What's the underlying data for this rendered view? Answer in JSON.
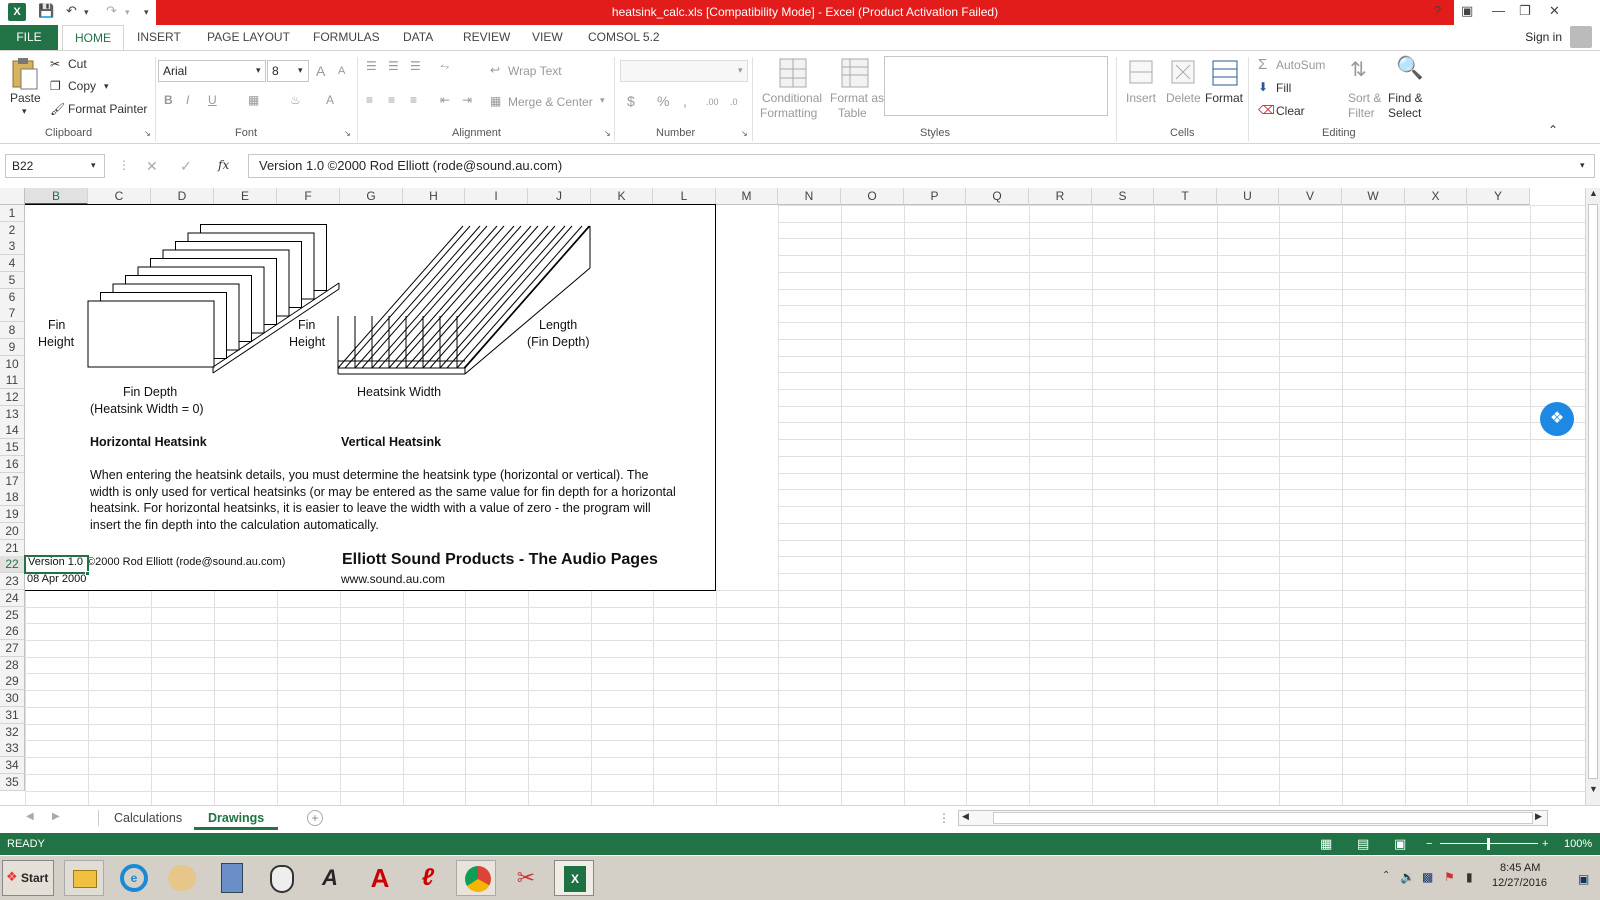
{
  "window": {
    "title": "heatsink_calc.xls  [Compatibility Mode] -  Excel (Product Activation Failed)",
    "help": "?",
    "min": "—",
    "max": "❐",
    "close": "✕"
  },
  "ribbon_tabs": [
    "FILE",
    "HOME",
    "INSERT",
    "PAGE LAYOUT",
    "FORMULAS",
    "DATA",
    "REVIEW",
    "VIEW",
    "COMSOL 5.2"
  ],
  "sign_in": "Sign in",
  "clipboard": {
    "paste": "Paste",
    "cut": "Cut",
    "copy": "Copy",
    "format_painter": "Format Painter",
    "label": "Clipboard"
  },
  "font": {
    "name": "Arial",
    "size": "8",
    "bold": "B",
    "italic": "I",
    "underline": "U",
    "label": "Font",
    "grow": "A",
    "shrink": "A",
    "color": "A"
  },
  "alignment": {
    "wrap_text": "Wrap Text",
    "merge_center": "Merge & Center",
    "label": "Alignment"
  },
  "number": {
    "format": "",
    "currency": "$",
    "percent": "%",
    "comma": ",",
    "inc_decimal": ".00",
    "dec_decimal": ".0",
    "label": "Number"
  },
  "styles": {
    "conditional": "Conditional",
    "conditional2": "Formatting",
    "format_as": "Format as",
    "format_as2": "Table",
    "label": "Styles"
  },
  "cells": {
    "insert": "Insert",
    "delete": "Delete",
    "format": "Format",
    "label": "Cells"
  },
  "editing": {
    "autosum": "AutoSum",
    "fill": "Fill",
    "clear": "Clear",
    "sort": "Sort &",
    "sort2": "Filter",
    "find": "Find &",
    "find2": "Select",
    "label": "Editing"
  },
  "formula_bar": {
    "name_box": "B22",
    "fx": "fx",
    "cancel": "✕",
    "enter": "✓",
    "content": "Version 1.0  ©2000 Rod Elliott (rode@sound.au.com)"
  },
  "columns": [
    "B",
    "C",
    "D",
    "E",
    "F",
    "G",
    "H",
    "I",
    "J",
    "K",
    "L",
    "M",
    "N",
    "O",
    "P",
    "Q",
    "R",
    "S",
    "T",
    "U",
    "V",
    "W",
    "X",
    "Y"
  ],
  "rows": [
    "1",
    "2",
    "3",
    "4",
    "5",
    "6",
    "7",
    "8",
    "9",
    "10",
    "11",
    "12",
    "13",
    "14",
    "15",
    "16",
    "17",
    "18",
    "19",
    "20",
    "21",
    "22",
    "23",
    "24",
    "25",
    "26",
    "27",
    "28",
    "29",
    "30",
    "31",
    "32",
    "33",
    "34",
    "35"
  ],
  "drawing": {
    "fin_height_left_1": "Fin",
    "fin_height_left_2": "Height",
    "fin_height_mid_1": "Fin",
    "fin_height_mid_2": "Height",
    "length_1": "Length",
    "length_2": "(Fin Depth)",
    "fin_depth_1": "Fin Depth",
    "fin_depth_2": "(Heatsink Width = 0)",
    "heatsink_width": "Heatsink Width",
    "horizontal": "Horizontal Heatsink",
    "vertical": "Vertical Heatsink",
    "para_1": "When entering the heatsink details, you must determine the heatsink type (horizontal or vertical).  The",
    "para_2": "width is only used for vertical heatsinks (or may be entered as the same value for fin depth for a horizontal",
    "para_3": "heatsink.  For horizontal heatsinks, it is easier to leave the width with a value of zero - the program will",
    "para_4": "insert the fin depth into the calculation automatically.",
    "version": "Version 1.0",
    "copyright": "©2000 Rod Elliott (rode@sound.au.com)",
    "esp_title": "Elliott Sound Products - The Audio Pages",
    "date": "08 Apr 2000",
    "website": "www.sound.au.com"
  },
  "sheets": {
    "calculations": "Calculations",
    "drawings": "Drawings",
    "add": "+"
  },
  "status": {
    "ready": "READY",
    "zoom": "100%",
    "minus": "−",
    "plus": "+"
  },
  "taskbar": {
    "start": "Start",
    "time": "8:45 AM",
    "date": "12/27/2016"
  }
}
